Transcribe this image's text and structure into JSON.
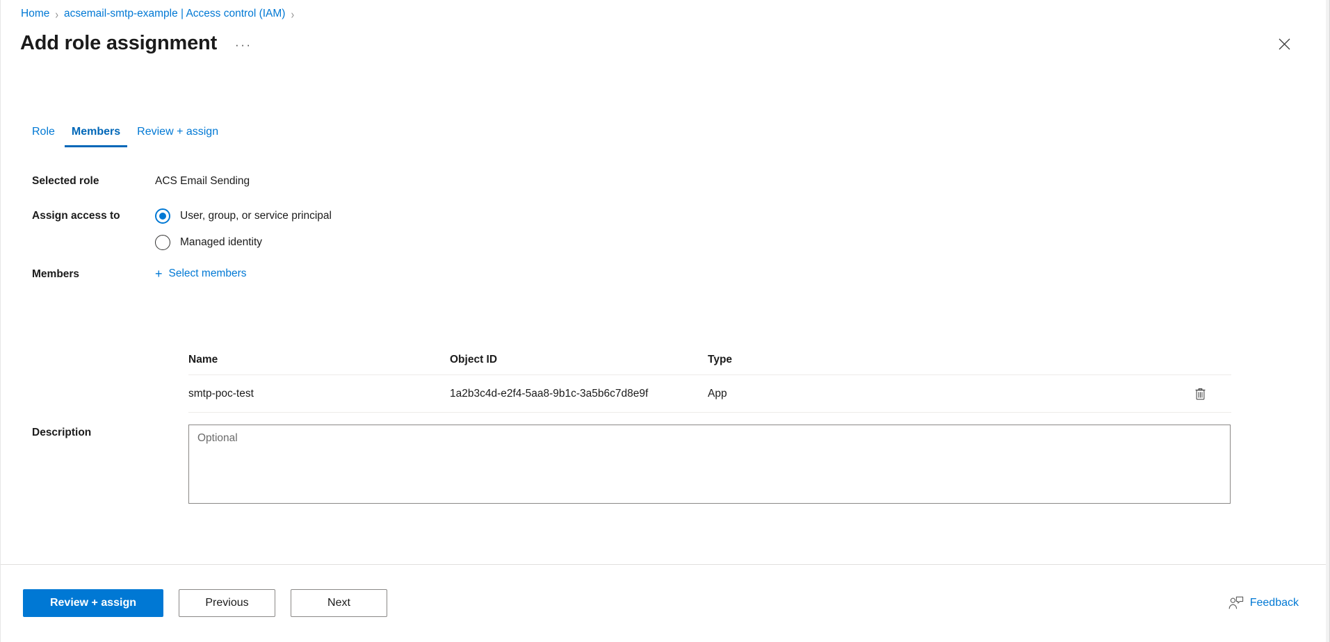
{
  "breadcrumb": {
    "items": [
      {
        "label": "Home"
      },
      {
        "label": "acsemail-smtp-example | Access control (IAM)"
      }
    ],
    "separator": "›",
    "trailing_separator": "›"
  },
  "header": {
    "title": "Add role assignment",
    "ellipsis": "···",
    "close_icon": "close-icon"
  },
  "tabs": [
    {
      "label": "Role",
      "selected": false
    },
    {
      "label": "Members",
      "selected": true
    },
    {
      "label": "Review + assign",
      "selected": false
    }
  ],
  "form": {
    "selected_role": {
      "label": "Selected role",
      "value": "ACS Email Sending"
    },
    "assign_access_to": {
      "label": "Assign access to",
      "options": [
        {
          "label": "User, group, or service principal",
          "checked": true
        },
        {
          "label": "Managed identity",
          "checked": false
        }
      ]
    },
    "members": {
      "label": "Members",
      "select_members_label": "Select members",
      "plus_icon": "+"
    },
    "description": {
      "label": "Description",
      "placeholder": "Optional",
      "value": ""
    }
  },
  "members_table": {
    "columns": [
      "Name",
      "Object ID",
      "Type"
    ],
    "rows": [
      {
        "name": "smtp-poc-test",
        "object_id": "1a2b3c4d-e2f4-5aa8-9b1c-3a5b6c7d8e9f",
        "type": "App",
        "delete_icon": "trash-icon"
      }
    ]
  },
  "footer": {
    "primary_button": "Review + assign",
    "previous_button": "Previous",
    "next_button": "Next",
    "feedback_label": "Feedback",
    "feedback_icon": "feedback-person-icon"
  },
  "colors": {
    "accent": "#0078d4",
    "link": "#0078d4",
    "text": "#1b1b1b",
    "border": "#8a8886",
    "table_border": "#edebe9"
  }
}
